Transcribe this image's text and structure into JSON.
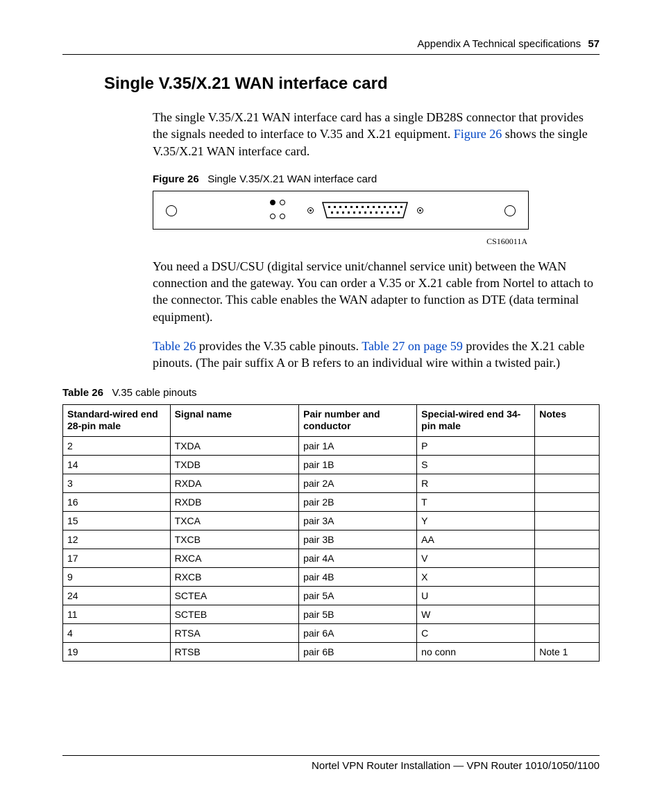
{
  "header": {
    "text": "Appendix A  Technical specifications",
    "page_number": "57"
  },
  "section_title": "Single V.35/X.21 WAN interface card",
  "para1_a": "The single V.35/X.21 WAN interface card has a single DB28S connector that provides the signals needed to interface to V.35 and X.21 equipment. ",
  "para1_link": "Figure 26",
  "para1_b": " shows the single V.35/X.21 WAN interface card.",
  "figure": {
    "label": "Figure 26",
    "caption": "Single V.35/X.21 WAN interface card",
    "code": "CS160011A"
  },
  "para2": "You need a DSU/CSU (digital service unit/channel service unit) between the WAN connection and the gateway. You can order a V.35 or X.21 cable from Nortel to attach to the connector. This cable enables the WAN adapter to function as DTE (data terminal equipment).",
  "para3_link1": "Table 26",
  "para3_a": " provides the V.35 cable pinouts. ",
  "para3_link2": "Table 27 on page 59",
  "para3_b": " provides the X.21 cable pinouts. (The pair suffix A or B refers to an individual wire within a twisted pair.)",
  "table": {
    "label": "Table 26",
    "caption": "V.35 cable pinouts",
    "headers": [
      "Standard-wired end 28-pin male",
      "Signal name",
      "Pair number and conductor",
      "Special-wired end 34-pin male",
      "Notes"
    ],
    "rows": [
      [
        "2",
        "TXDA",
        "pair 1A",
        "P",
        ""
      ],
      [
        "14",
        "TXDB",
        "pair 1B",
        "S",
        ""
      ],
      [
        "3",
        "RXDA",
        "pair 2A",
        "R",
        ""
      ],
      [
        "16",
        "RXDB",
        "pair 2B",
        "T",
        ""
      ],
      [
        "15",
        "TXCA",
        "pair 3A",
        "Y",
        ""
      ],
      [
        "12",
        "TXCB",
        "pair 3B",
        "AA",
        ""
      ],
      [
        "17",
        "RXCA",
        "pair 4A",
        "V",
        ""
      ],
      [
        "9",
        "RXCB",
        "pair 4B",
        "X",
        ""
      ],
      [
        "24",
        "SCTEA",
        "pair 5A",
        "U",
        ""
      ],
      [
        "11",
        "SCTEB",
        "pair 5B",
        "W",
        ""
      ],
      [
        "4",
        "RTSA",
        "pair 6A",
        "C",
        ""
      ],
      [
        "19",
        "RTSB",
        "pair 6B",
        "no conn",
        "Note 1"
      ]
    ]
  },
  "footer": "Nortel VPN Router Installation — VPN Router 1010/1050/1100"
}
